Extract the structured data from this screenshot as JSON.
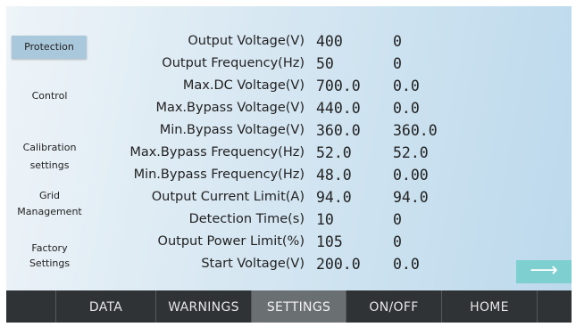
{
  "sidebar": {
    "items": [
      {
        "label": "Protection",
        "active": true
      },
      {
        "label": "Control"
      },
      {
        "label_line1": "Calibration",
        "label_line2": "settings"
      },
      {
        "label_line1": "Grid",
        "label_line2": "Management"
      },
      {
        "label_line1": "Factory",
        "label_line2": "Settings"
      }
    ]
  },
  "params": [
    {
      "label": "Output Voltage(V)",
      "value1": "400",
      "value2": "0"
    },
    {
      "label": "Output Frequency(Hz)",
      "value1": "50",
      "value2": "0"
    },
    {
      "label": "Max.DC Voltage(V)",
      "value1": "700.0",
      "value2": "0.0"
    },
    {
      "label": "Max.Bypass Voltage(V)",
      "value1": "440.0",
      "value2": "0.0"
    },
    {
      "label": "Min.Bypass Voltage(V)",
      "value1": "360.0",
      "value2": "360.0"
    },
    {
      "label": "Max.Bypass Frequency(Hz)",
      "value1": "52.0",
      "value2": "52.0"
    },
    {
      "label": "Min.Bypass Frequency(Hz)",
      "value1": "48.0",
      "value2": "0.00"
    },
    {
      "label": "Output Current Limit(A)",
      "value1": "94.0",
      "value2": "94.0"
    },
    {
      "label": "Detection Time(s)",
      "value1": "10",
      "value2": "0"
    },
    {
      "label": "Output Power Limit(%)",
      "value1": "105",
      "value2": "0"
    },
    {
      "label": "Start Voltage(V)",
      "value1": "200.0",
      "value2": "0.0"
    }
  ],
  "next_button": {
    "icon": "arrow-right-icon",
    "glyph": "⟶"
  },
  "nav": {
    "items": [
      {
        "label": "DATA"
      },
      {
        "label": "WARNINGS"
      },
      {
        "label": "SETTINGS",
        "active": true
      },
      {
        "label": "ON/OFF"
      },
      {
        "label": "HOME"
      }
    ]
  },
  "colors": {
    "nav_bg": "#2f3335",
    "nav_active": "#6a6f72",
    "sidebar_active": "#a9c8dc",
    "next_button": "#7ecfcf"
  }
}
